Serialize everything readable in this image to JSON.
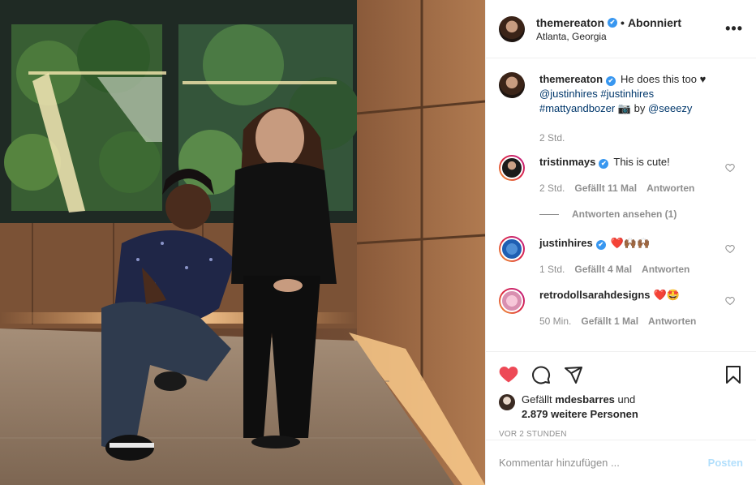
{
  "header": {
    "username": "themereaton",
    "verified_mark": "✔",
    "separator": "•",
    "follow_status": "Abonniert",
    "location": "Atlanta, Georgia",
    "more_icon": "•••"
  },
  "caption": {
    "username": "themereaton",
    "text": "He does this too ♥",
    "tags": [
      "@justinhires",
      "#justinhires",
      "#mattyandbozer"
    ],
    "camera": "📷",
    "by": "by",
    "credit": "@seeezy",
    "time": "2 Std."
  },
  "comments": [
    {
      "username": "tristinmays",
      "verified": true,
      "text": "This is cute!",
      "time": "2 Std.",
      "likes": "Gefällt 11 Mal",
      "reply": "Antworten",
      "view_replies": "Antworten ansehen (1)"
    },
    {
      "username": "justinhires",
      "verified": true,
      "text": "❤️🙌🏾🙌🏾",
      "time": "1 Std.",
      "likes": "Gefällt 4 Mal",
      "reply": "Antworten"
    },
    {
      "username": "retrodollsarahdesigns",
      "verified": false,
      "text": "❤️🤩",
      "time": "50 Min.",
      "likes": "Gefällt 1 Mal",
      "reply": "Antworten"
    }
  ],
  "likes": {
    "prefix": "Gefällt",
    "user": "mdesbarres",
    "mid": "und",
    "count": "2.879 weitere Personen"
  },
  "timestamp": "VOR 2 STUNDEN",
  "add_comment": {
    "placeholder": "Kommentar hinzufügen ...",
    "post_label": "Posten"
  },
  "colors": {
    "like_red": "#ed4956",
    "verified_blue": "#3897f0",
    "link": "#00376b",
    "post_disabled": "#b2dffc"
  },
  "icons": [
    "heart-filled-icon",
    "comment-icon",
    "share-icon",
    "bookmark-icon"
  ]
}
